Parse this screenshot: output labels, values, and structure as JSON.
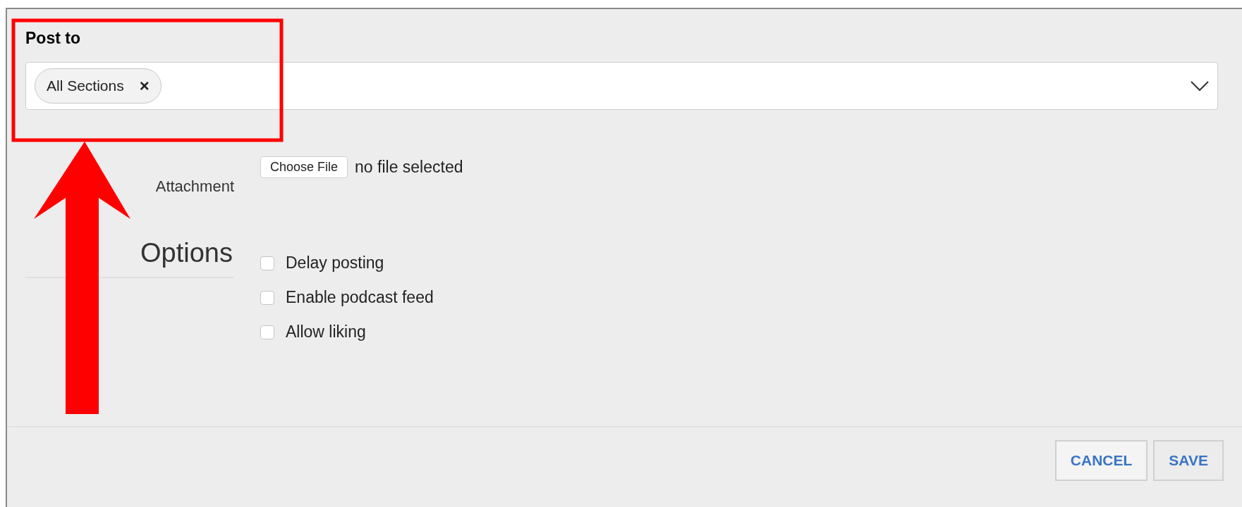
{
  "post_to": {
    "label": "Post to",
    "chips": [
      {
        "label": "All Sections",
        "remove": "×"
      }
    ]
  },
  "attachment": {
    "label": "Attachment",
    "button": "Choose File",
    "status": "no file selected"
  },
  "options": {
    "label": "Options",
    "items": [
      {
        "label": "Delay posting",
        "checked": false
      },
      {
        "label": "Enable podcast feed",
        "checked": false
      },
      {
        "label": "Allow liking",
        "checked": false
      }
    ]
  },
  "buttons": [
    "CANCEL",
    "SAVE"
  ],
  "annotation": {
    "color": "#ff0000"
  }
}
